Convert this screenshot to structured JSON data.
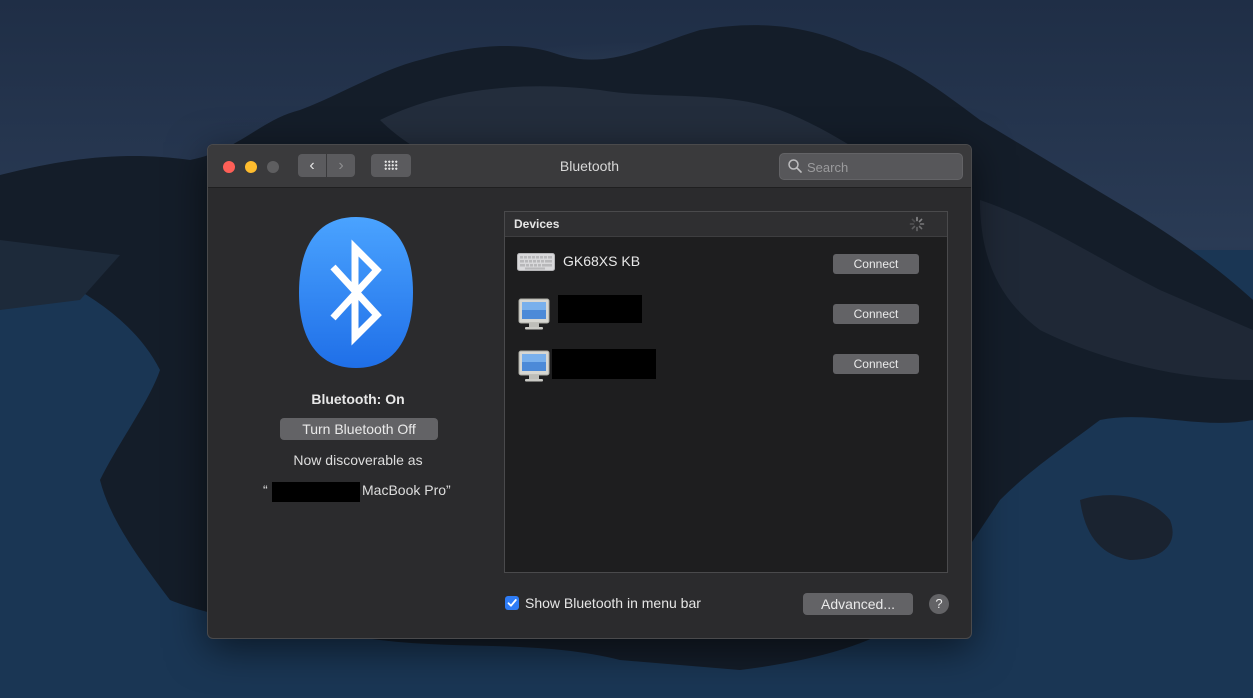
{
  "window": {
    "title": "Bluetooth",
    "search_placeholder": "Search",
    "nav_back_symbol": "‹",
    "nav_forward_symbol": "›"
  },
  "left_pane": {
    "status": "Bluetooth: On",
    "toggle_button": "Turn Bluetooth Off",
    "discoverable_text": "Now discoverable as",
    "device_name_open_quote": "“",
    "device_name_visible": "MacBook Pro”"
  },
  "devices": {
    "header": "Devices",
    "items": [
      {
        "label": "GK68XS KB",
        "icon": "keyboard-icon",
        "action": "Connect"
      },
      {
        "label": "",
        "icon": "computer-icon",
        "action": "Connect"
      },
      {
        "label": "",
        "icon": "computer-icon",
        "action": "Connect"
      }
    ]
  },
  "footer": {
    "show_in_menu_bar_label": "Show Bluetooth in menu bar",
    "show_in_menu_bar_checked": true,
    "advanced_button": "Advanced...",
    "help_button": "?"
  },
  "colors": {
    "bluetooth_blue": "#2e7cf6",
    "close": "#fe5f57",
    "minimize": "#febc2e"
  }
}
